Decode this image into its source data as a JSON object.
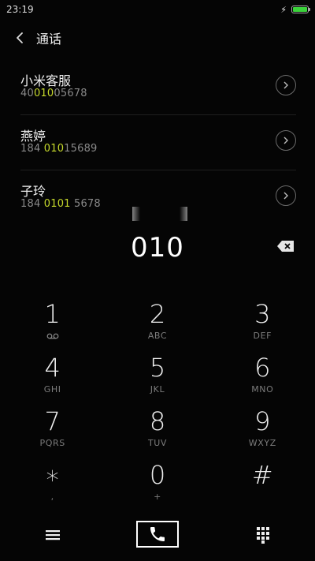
{
  "status": {
    "time": "23:19",
    "battery_color": "#3bd33b",
    "battery_level": 1.0
  },
  "header": {
    "title": "通话"
  },
  "results": [
    {
      "name": "小米客服",
      "number_pre": "40",
      "number_match": "010",
      "number_post": "05678"
    },
    {
      "name": "燕婷",
      "number_pre": "184 ",
      "number_match": "010",
      "number_post": "15689"
    },
    {
      "name": "子玲",
      "number_pre": "184 ",
      "number_match": "0101",
      "number_post": " 5678"
    }
  ],
  "highlight_color": "#c6d92b",
  "dialer": {
    "input": "010"
  },
  "keypad": [
    {
      "digit": "1",
      "sub": "",
      "icon": "voicemail-icon"
    },
    {
      "digit": "2",
      "sub": "ABC"
    },
    {
      "digit": "3",
      "sub": "DEF"
    },
    {
      "digit": "4",
      "sub": "GHI"
    },
    {
      "digit": "5",
      "sub": "JKL"
    },
    {
      "digit": "6",
      "sub": "MNO"
    },
    {
      "digit": "7",
      "sub": "PQRS"
    },
    {
      "digit": "8",
      "sub": "TUV"
    },
    {
      "digit": "9",
      "sub": "WXYZ"
    },
    {
      "digit": "∗",
      "sub": ","
    },
    {
      "digit": "0",
      "sub": "+"
    },
    {
      "digit": "#",
      "sub": ""
    }
  ],
  "bottom": {
    "icons": [
      "menu-icon",
      "phone-icon",
      "keypad-icon"
    ]
  }
}
